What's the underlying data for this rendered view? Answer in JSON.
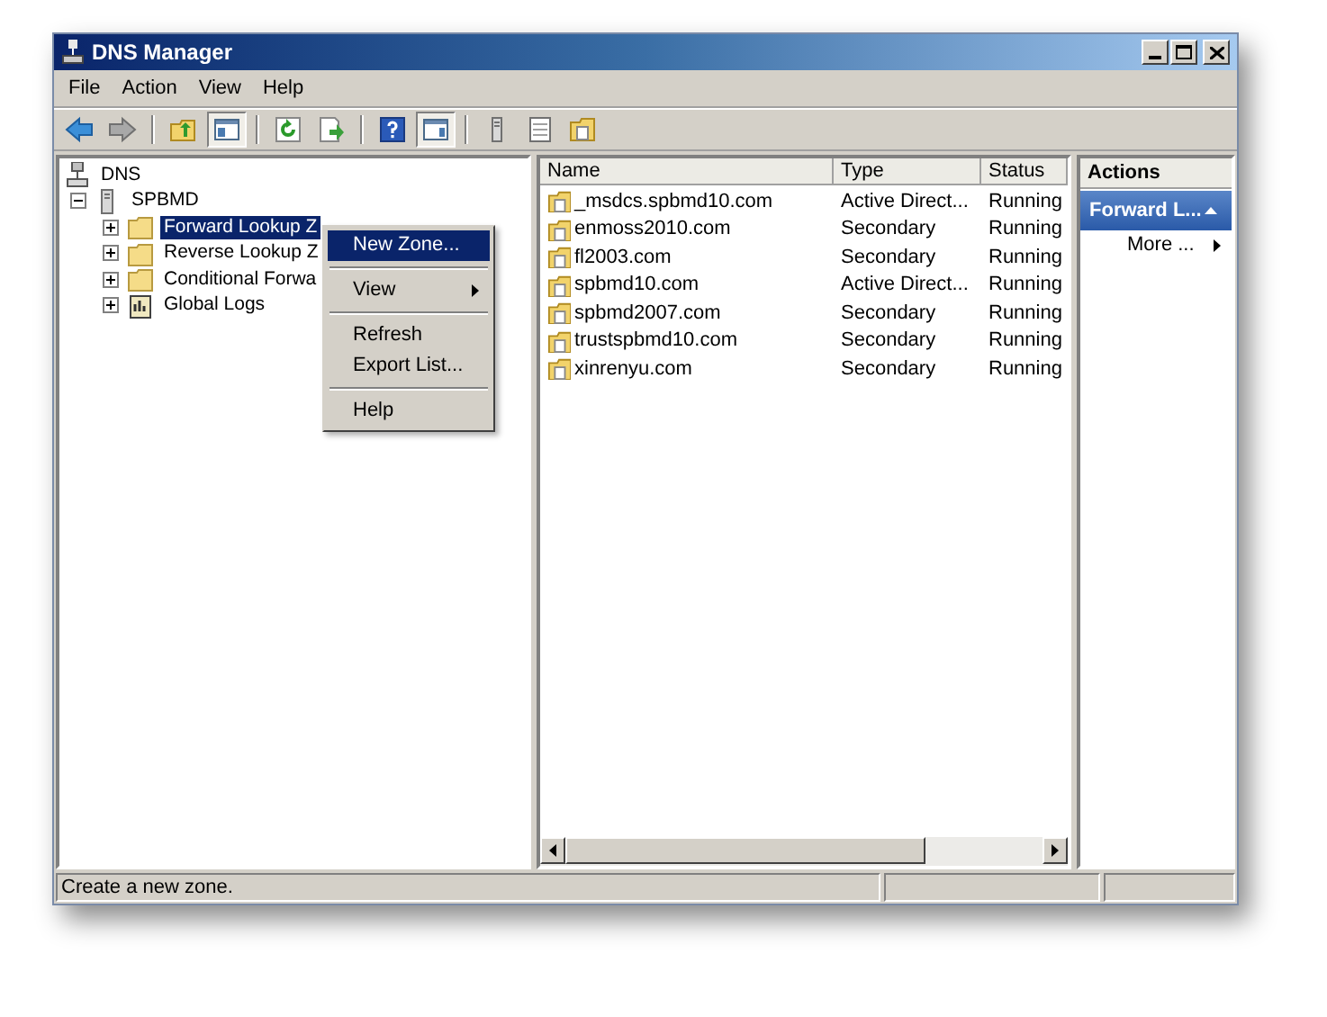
{
  "window": {
    "title": "DNS Manager"
  },
  "menu_bar": [
    "File",
    "Action",
    "View",
    "Help"
  ],
  "toolbar": [
    {
      "kind": "back",
      "pressed": false
    },
    {
      "kind": "forward",
      "pressed": false
    },
    {
      "kind": "separator"
    },
    {
      "kind": "up",
      "pressed": false
    },
    {
      "kind": "tree",
      "pressed": true
    },
    {
      "kind": "separator"
    },
    {
      "kind": "refresh",
      "pressed": false
    },
    {
      "kind": "export",
      "pressed": false
    },
    {
      "kind": "separator"
    },
    {
      "kind": "help",
      "pressed": false
    },
    {
      "kind": "actionpane",
      "pressed": true
    },
    {
      "kind": "separator"
    },
    {
      "kind": "server",
      "pressed": false
    },
    {
      "kind": "list",
      "pressed": false
    },
    {
      "kind": "zone",
      "pressed": false
    }
  ],
  "tree": [
    {
      "label": "DNS",
      "kind": "dns",
      "children": [
        {
          "label": "SPBMD",
          "kind": "server",
          "expanded": true,
          "selected": false,
          "children": [
            {
              "label": "Forward Lookup Z",
              "kind": "folder",
              "expanded": false,
              "selected": true
            },
            {
              "label": "Reverse Lookup Z",
              "kind": "folder",
              "expanded": false,
              "selected": false
            },
            {
              "label": "Conditional Forwa",
              "kind": "folder",
              "expanded": false,
              "selected": false
            },
            {
              "label": "Global Logs",
              "kind": "log",
              "expanded": false,
              "selected": false
            }
          ]
        }
      ]
    }
  ],
  "context_menu": {
    "groups": [
      [
        {
          "label": "New Zone...",
          "selected": true,
          "submenu": false
        }
      ],
      [
        {
          "label": "View",
          "selected": false,
          "submenu": true
        }
      ],
      [
        {
          "label": "Refresh",
          "selected": false,
          "submenu": false
        },
        {
          "label": "Export List...",
          "selected": false,
          "submenu": false
        }
      ],
      [
        {
          "label": "Help",
          "selected": false,
          "submenu": false
        }
      ]
    ]
  },
  "table": {
    "columns": [
      "Name",
      "Type",
      "Status"
    ],
    "rows": [
      [
        "_msdcs.spbmd10.com",
        "Active Direct...",
        "Running"
      ],
      [
        "enmoss2010.com",
        "Secondary",
        "Running"
      ],
      [
        "fl2003.com",
        "Secondary",
        "Running"
      ],
      [
        "spbmd10.com",
        "Active Direct...",
        "Running"
      ],
      [
        "spbmd2007.com",
        "Secondary",
        "Running"
      ],
      [
        "trustspbmd10.com",
        "Secondary",
        "Running"
      ],
      [
        "xinrenyu.com",
        "Secondary",
        "Running"
      ]
    ]
  },
  "actions": {
    "title": "Actions",
    "section": "Forward L...",
    "items": [
      "More ..."
    ]
  },
  "status_bar": [
    "Create a new zone."
  ]
}
